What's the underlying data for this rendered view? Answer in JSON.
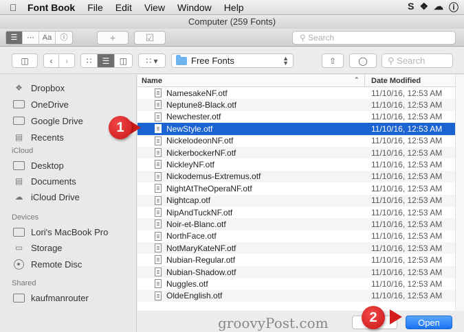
{
  "menubar": {
    "app": "Font Book",
    "items": [
      "File",
      "Edit",
      "View",
      "Window",
      "Help"
    ]
  },
  "fontbook": {
    "title": "Computer (259 Fonts)",
    "search_placeholder": "Search"
  },
  "dialog": {
    "location": "Free Fonts",
    "search_placeholder": "Search",
    "sidebar": {
      "favorites": [
        "Dropbox",
        "OneDrive",
        "Google Drive",
        "Recents"
      ],
      "icloud_header": "iCloud",
      "icloud": [
        "Desktop",
        "Documents",
        "iCloud Drive"
      ],
      "devices_header": "Devices",
      "devices": [
        "Lori's MacBook Pro",
        "Storage",
        "Remote Disc"
      ],
      "shared_header": "Shared",
      "shared": [
        "kaufmanrouter"
      ]
    },
    "columns": {
      "name": "Name",
      "date": "Date Modified"
    },
    "files": [
      {
        "name": "NamesakeNF.otf",
        "date": "11/10/16, 12:53 AM"
      },
      {
        "name": "Neptune8-Black.otf",
        "date": "11/10/16, 12:53 AM"
      },
      {
        "name": "Newchester.otf",
        "date": "11/10/16, 12:53 AM"
      },
      {
        "name": "NewStyle.otf",
        "date": "11/10/16, 12:53 AM"
      },
      {
        "name": "NickelodeonNF.otf",
        "date": "11/10/16, 12:53 AM"
      },
      {
        "name": "NickerbockerNF.otf",
        "date": "11/10/16, 12:53 AM"
      },
      {
        "name": "NickleyNF.otf",
        "date": "11/10/16, 12:53 AM"
      },
      {
        "name": "Nickodemus-Extremus.otf",
        "date": "11/10/16, 12:53 AM"
      },
      {
        "name": "NightAtTheOperaNF.otf",
        "date": "11/10/16, 12:53 AM"
      },
      {
        "name": "Nightcap.otf",
        "date": "11/10/16, 12:53 AM"
      },
      {
        "name": "NipAndTuckNF.otf",
        "date": "11/10/16, 12:53 AM"
      },
      {
        "name": "Noir-et-Blanc.otf",
        "date": "11/10/16, 12:53 AM"
      },
      {
        "name": "NorthFace.otf",
        "date": "11/10/16, 12:53 AM"
      },
      {
        "name": "NotMaryKateNF.otf",
        "date": "11/10/16, 12:53 AM"
      },
      {
        "name": "Nubian-Regular.otf",
        "date": "11/10/16, 12:53 AM"
      },
      {
        "name": "Nubian-Shadow.otf",
        "date": "11/10/16, 12:53 AM"
      },
      {
        "name": "Nuggles.otf",
        "date": "11/10/16, 12:53 AM"
      },
      {
        "name": "OldeEnglish.otf",
        "date": "11/10/16, 12:53 AM"
      }
    ],
    "selected_file": "NewStyle.otf",
    "open_label": "Open",
    "watermark": "groovyPost.com"
  },
  "callouts": [
    "1",
    "2"
  ],
  "colors": {
    "selection": "#1a63d0",
    "accent": "#1a72f0",
    "callout": "#d21c1c"
  }
}
